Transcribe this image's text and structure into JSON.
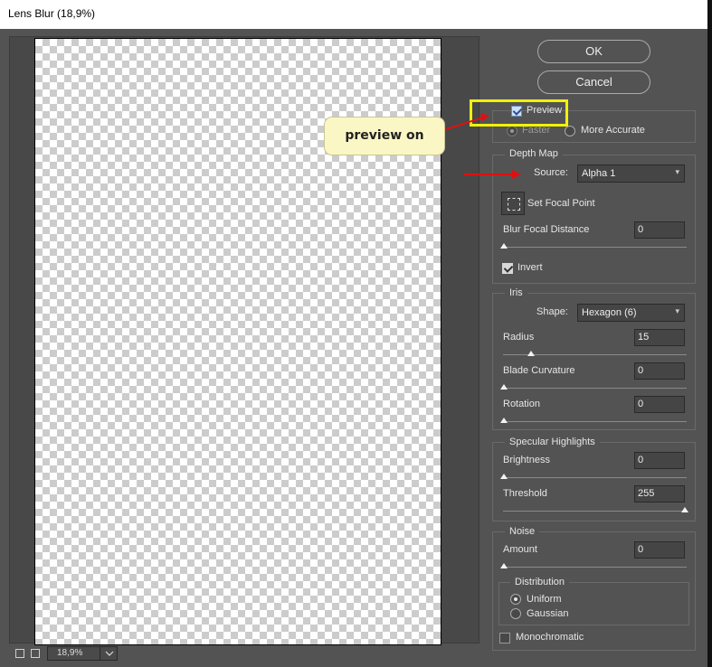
{
  "window": {
    "title": "Lens Blur (18,9%)"
  },
  "buttons": {
    "ok": "OK",
    "cancel": "Cancel"
  },
  "preview": {
    "checkbox_label": "Preview",
    "checked": true,
    "faster": "Faster",
    "more_accurate": "More Accurate",
    "selected": "Faster"
  },
  "depth_map": {
    "legend": "Depth Map",
    "source_label": "Source:",
    "source_value": "Alpha 1",
    "set_focal_point": "Set Focal Point",
    "blur_focal_distance_label": "Blur Focal Distance",
    "blur_focal_distance_value": "0",
    "invert_label": "Invert",
    "invert_checked": true
  },
  "iris": {
    "legend": "Iris",
    "shape_label": "Shape:",
    "shape_value": "Hexagon (6)",
    "radius_label": "Radius",
    "radius_value": "15",
    "blade_curvature_label": "Blade Curvature",
    "blade_curvature_value": "0",
    "rotation_label": "Rotation",
    "rotation_value": "0"
  },
  "specular": {
    "legend": "Specular Highlights",
    "brightness_label": "Brightness",
    "brightness_value": "0",
    "threshold_label": "Threshold",
    "threshold_value": "255"
  },
  "noise": {
    "legend": "Noise",
    "amount_label": "Amount",
    "amount_value": "0",
    "distribution_legend": "Distribution",
    "uniform": "Uniform",
    "gaussian": "Gaussian",
    "distribution_selected": "Uniform",
    "monochromatic_label": "Monochromatic",
    "monochromatic_checked": false
  },
  "zoom": {
    "value": "18,9%"
  },
  "annotation": {
    "callout_text": "preview on",
    "highlight_color": "#f1f10a",
    "arrow_color": "#e01010"
  }
}
